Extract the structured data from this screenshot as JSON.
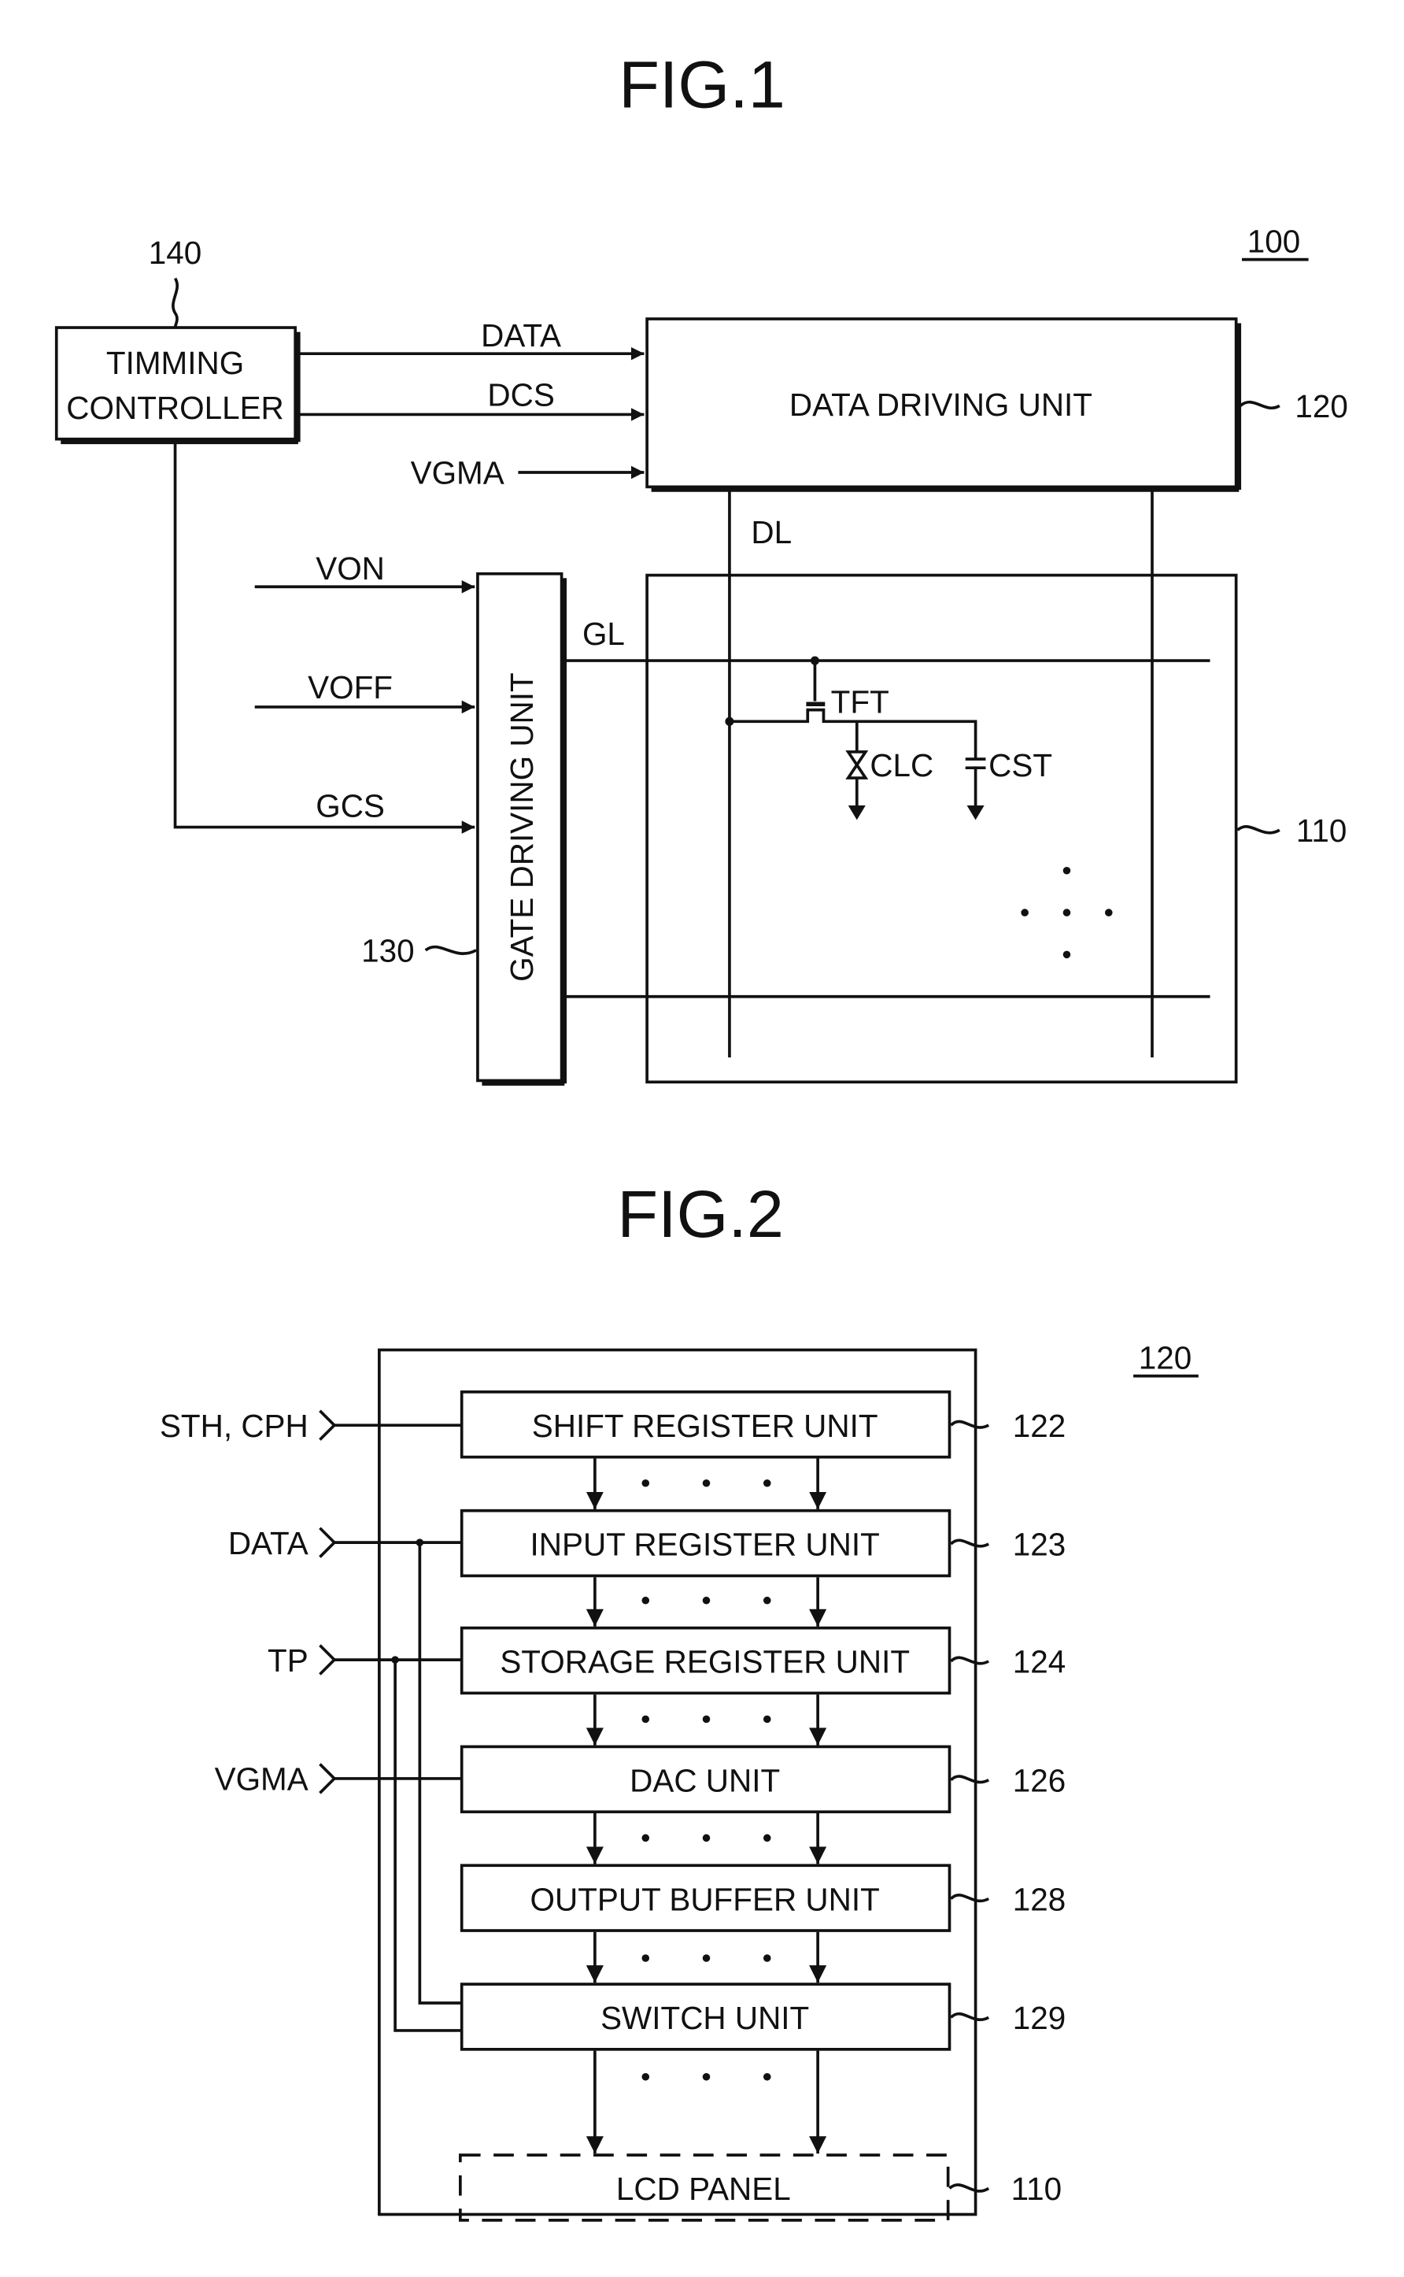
{
  "fig1": {
    "title": "FIG.1",
    "ref_system": "100",
    "timing_controller": {
      "line1": "TIMMING",
      "line2": "CONTROLLER",
      "ref": "140"
    },
    "data_driving_unit": {
      "label": "DATA DRIVING UNIT",
      "ref": "120"
    },
    "gate_driving_unit": {
      "label": "GATE DRIVING UNIT",
      "ref": "130"
    },
    "lcd_panel": {
      "ref": "110"
    },
    "signals": {
      "data": "DATA",
      "dcs": "DCS",
      "vgma": "VGMA",
      "von": "VON",
      "voff": "VOFF",
      "gcs": "GCS",
      "dl": "DL",
      "gl": "GL"
    },
    "pixel": {
      "tft": "TFT",
      "clc": "CLC",
      "cst": "CST"
    }
  },
  "fig2": {
    "title": "FIG.2",
    "ref_block": "120",
    "inputs": [
      "STH, CPH",
      "DATA",
      "TP",
      "VGMA"
    ],
    "units": [
      {
        "label": "SHIFT REGISTER UNIT",
        "ref": "122"
      },
      {
        "label": "INPUT REGISTER UNIT",
        "ref": "123"
      },
      {
        "label": "STORAGE REGISTER UNIT",
        "ref": "124"
      },
      {
        "label": "DAC UNIT",
        "ref": "126"
      },
      {
        "label": "OUTPUT BUFFER UNIT",
        "ref": "128"
      },
      {
        "label": "SWITCH UNIT",
        "ref": "129"
      }
    ],
    "lcd_panel": {
      "label": "LCD PANEL",
      "ref": "110"
    }
  }
}
